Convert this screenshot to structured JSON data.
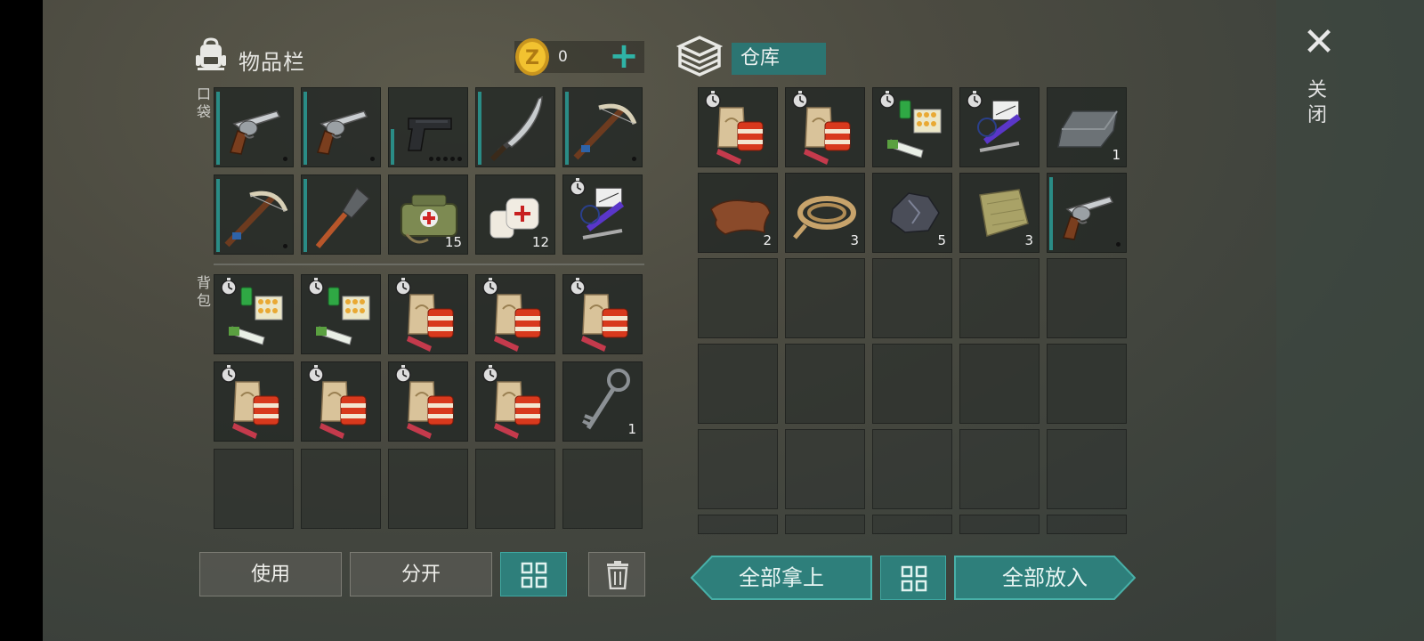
{
  "inventory": {
    "title": "物品栏",
    "coins": "0",
    "pocket_label": "口袋",
    "backpack_label": "背包",
    "pocket_slots": [
      {
        "icon": "revolver-icon",
        "count": "",
        "dots": 1,
        "bar": "full"
      },
      {
        "icon": "revolver-icon",
        "count": "",
        "dots": 1,
        "bar": "full"
      },
      {
        "icon": "pistol-icon",
        "count": "",
        "dots": 5,
        "bar": "low"
      },
      {
        "icon": "machete-icon",
        "count": "",
        "dots": 0,
        "bar": "full"
      },
      {
        "icon": "crossbow-icon",
        "count": "",
        "dots": 1,
        "bar": "full"
      },
      {
        "icon": "crossbow-icon",
        "count": "",
        "dots": 1,
        "bar": "full"
      },
      {
        "icon": "shovel-icon",
        "count": "",
        "dots": 0,
        "bar": "full"
      },
      {
        "icon": "medkit-bag-icon",
        "count": "15",
        "dots": 0,
        "bar": ""
      },
      {
        "icon": "bandage-icon",
        "count": "12",
        "dots": 0,
        "bar": ""
      },
      {
        "icon": "repair-kit-icon",
        "count": "",
        "dots": 0,
        "bar": ""
      }
    ],
    "backpack_slots": [
      {
        "icon": "medicine-pack-icon",
        "count": ""
      },
      {
        "icon": "medicine-pack-icon",
        "count": ""
      },
      {
        "icon": "food-pack-icon",
        "count": ""
      },
      {
        "icon": "food-pack-icon",
        "count": ""
      },
      {
        "icon": "food-pack-icon",
        "count": ""
      },
      {
        "icon": "food-pack-icon",
        "count": ""
      },
      {
        "icon": "food-pack-icon",
        "count": ""
      },
      {
        "icon": "food-pack-icon",
        "count": ""
      },
      {
        "icon": "food-pack-icon",
        "count": ""
      },
      {
        "icon": "key-icon",
        "count": "1"
      },
      {
        "icon": "",
        "count": ""
      },
      {
        "icon": "",
        "count": ""
      },
      {
        "icon": "",
        "count": ""
      },
      {
        "icon": "",
        "count": ""
      },
      {
        "icon": "",
        "count": ""
      }
    ]
  },
  "storage": {
    "title": "仓库",
    "slots": [
      {
        "icon": "food-pack-icon",
        "count": ""
      },
      {
        "icon": "food-pack-icon",
        "count": ""
      },
      {
        "icon": "medicine-pack-icon",
        "count": ""
      },
      {
        "icon": "repair-kit-icon",
        "count": ""
      },
      {
        "icon": "iron-ingot-icon",
        "count": "1"
      },
      {
        "icon": "leather-icon",
        "count": "2"
      },
      {
        "icon": "rope-icon",
        "count": "3"
      },
      {
        "icon": "coal-ore-icon",
        "count": "5"
      },
      {
        "icon": "cloth-icon",
        "count": "3"
      },
      {
        "icon": "revolver-icon",
        "count": "",
        "dots": 1,
        "bar": "full"
      }
    ]
  },
  "buttons": {
    "use": "使用",
    "split": "分开",
    "take_all": "全部拿上",
    "put_all": "全部放入"
  },
  "close_label": "关闭",
  "colors": {
    "accent": "#2e7f7b",
    "accent_bright": "#2fb3a6",
    "quality_bar": "#2a8c86"
  }
}
